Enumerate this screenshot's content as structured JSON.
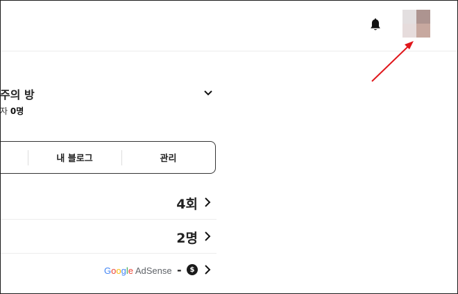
{
  "header": {
    "notification_icon": "bell-icon",
    "profile_avatar_colors": [
      "#e3dfe0",
      "#ad9490",
      "#e6dcdc",
      "#c7a89f"
    ],
    "annotation_arrow_color": "#e0161b"
  },
  "blog": {
    "title": "주의 방",
    "subscribers_prefix": "자",
    "subscribers_count": "0명"
  },
  "nav": {
    "my_blog_label": "내 블로그",
    "manage_label": "관리"
  },
  "stats": {
    "visits_value": "4회",
    "subscribers_value": "2명",
    "adsense_logo_google": [
      "G",
      "o",
      "o",
      "g",
      "l",
      "e"
    ],
    "adsense_logo_text": "AdSense",
    "adsense_value": "-",
    "adsense_currency_icon": "$"
  }
}
